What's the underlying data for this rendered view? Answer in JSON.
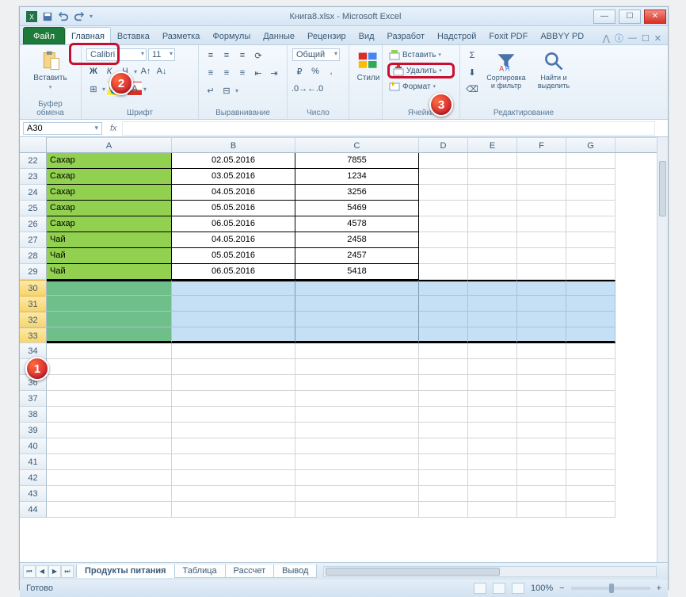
{
  "window": {
    "title": "Книга8.xlsx - Microsoft Excel",
    "qat_items": [
      "excel",
      "save",
      "undo",
      "redo",
      "customize"
    ]
  },
  "tabs": {
    "file": "Файл",
    "items": [
      "Главная",
      "Вставка",
      "Разметка",
      "Формулы",
      "Данные",
      "Рецензир",
      "Вид",
      "Разработ",
      "Надстрой",
      "Foxit PDF",
      "ABBYY PD"
    ],
    "active_index": 0
  },
  "ribbon": {
    "clipboard": {
      "paste": "Вставить",
      "label": "Буфер обмена"
    },
    "font": {
      "name": "Calibri",
      "size": "11",
      "label": "Шрифт"
    },
    "alignment": {
      "label": "Выравнивание"
    },
    "number": {
      "format": "Общий",
      "label": "Число"
    },
    "styles": {
      "btn": "Стили",
      "label": ""
    },
    "cells": {
      "insert": "Вставить",
      "delete": "Удалить",
      "format": "Формат",
      "label": "Ячейки"
    },
    "editing": {
      "sort": "Сортировка и фильтр",
      "find": "Найти и выделить",
      "label": "Редактирование"
    }
  },
  "formula_bar": {
    "name_box": "A30",
    "fx": "fx"
  },
  "columns": [
    "A",
    "B",
    "C",
    "D",
    "E",
    "F",
    "G"
  ],
  "rows": [
    {
      "n": 22,
      "a": "Сахар",
      "b": "02.05.2016",
      "c": "7855",
      "data": true
    },
    {
      "n": 23,
      "a": "Сахар",
      "b": "03.05.2016",
      "c": "1234",
      "data": true
    },
    {
      "n": 24,
      "a": "Сахар",
      "b": "04.05.2016",
      "c": "3256",
      "data": true
    },
    {
      "n": 25,
      "a": "Сахар",
      "b": "05.05.2016",
      "c": "5469",
      "data": true
    },
    {
      "n": 26,
      "a": "Сахар",
      "b": "06.05.2016",
      "c": "4578",
      "data": true
    },
    {
      "n": 27,
      "a": "Чай",
      "b": "04.05.2016",
      "c": "2458",
      "data": true
    },
    {
      "n": 28,
      "a": "Чай",
      "b": "05.05.2016",
      "c": "2457",
      "data": true
    },
    {
      "n": 29,
      "a": "Чай",
      "b": "06.05.2016",
      "c": "5418",
      "data": true
    },
    {
      "n": 30,
      "a": "",
      "b": "",
      "c": "",
      "sel": true
    },
    {
      "n": 31,
      "a": "",
      "b": "",
      "c": "",
      "sel": true
    },
    {
      "n": 32,
      "a": "",
      "b": "",
      "c": "",
      "sel": true
    },
    {
      "n": 33,
      "a": "",
      "b": "",
      "c": "",
      "sel": true
    },
    {
      "n": 34,
      "a": "",
      "b": "",
      "c": ""
    },
    {
      "n": 35,
      "a": "",
      "b": "",
      "c": ""
    },
    {
      "n": 36,
      "a": "",
      "b": "",
      "c": ""
    },
    {
      "n": 37,
      "a": "",
      "b": "",
      "c": ""
    },
    {
      "n": 38,
      "a": "",
      "b": "",
      "c": ""
    },
    {
      "n": 39,
      "a": "",
      "b": "",
      "c": ""
    },
    {
      "n": 40,
      "a": "",
      "b": "",
      "c": ""
    },
    {
      "n": 41,
      "a": "",
      "b": "",
      "c": ""
    },
    {
      "n": 42,
      "a": "",
      "b": "",
      "c": ""
    },
    {
      "n": 43,
      "a": "",
      "b": "",
      "c": ""
    },
    {
      "n": 44,
      "a": "",
      "b": "",
      "c": ""
    }
  ],
  "sheet_tabs": {
    "items": [
      "Продукты питания",
      "Таблица",
      "Рассчет",
      "Вывод"
    ],
    "active_index": 0
  },
  "statusbar": {
    "status": "Готово",
    "zoom": "100%"
  },
  "callouts": {
    "c1": "1",
    "c2": "2",
    "c3": "3"
  }
}
